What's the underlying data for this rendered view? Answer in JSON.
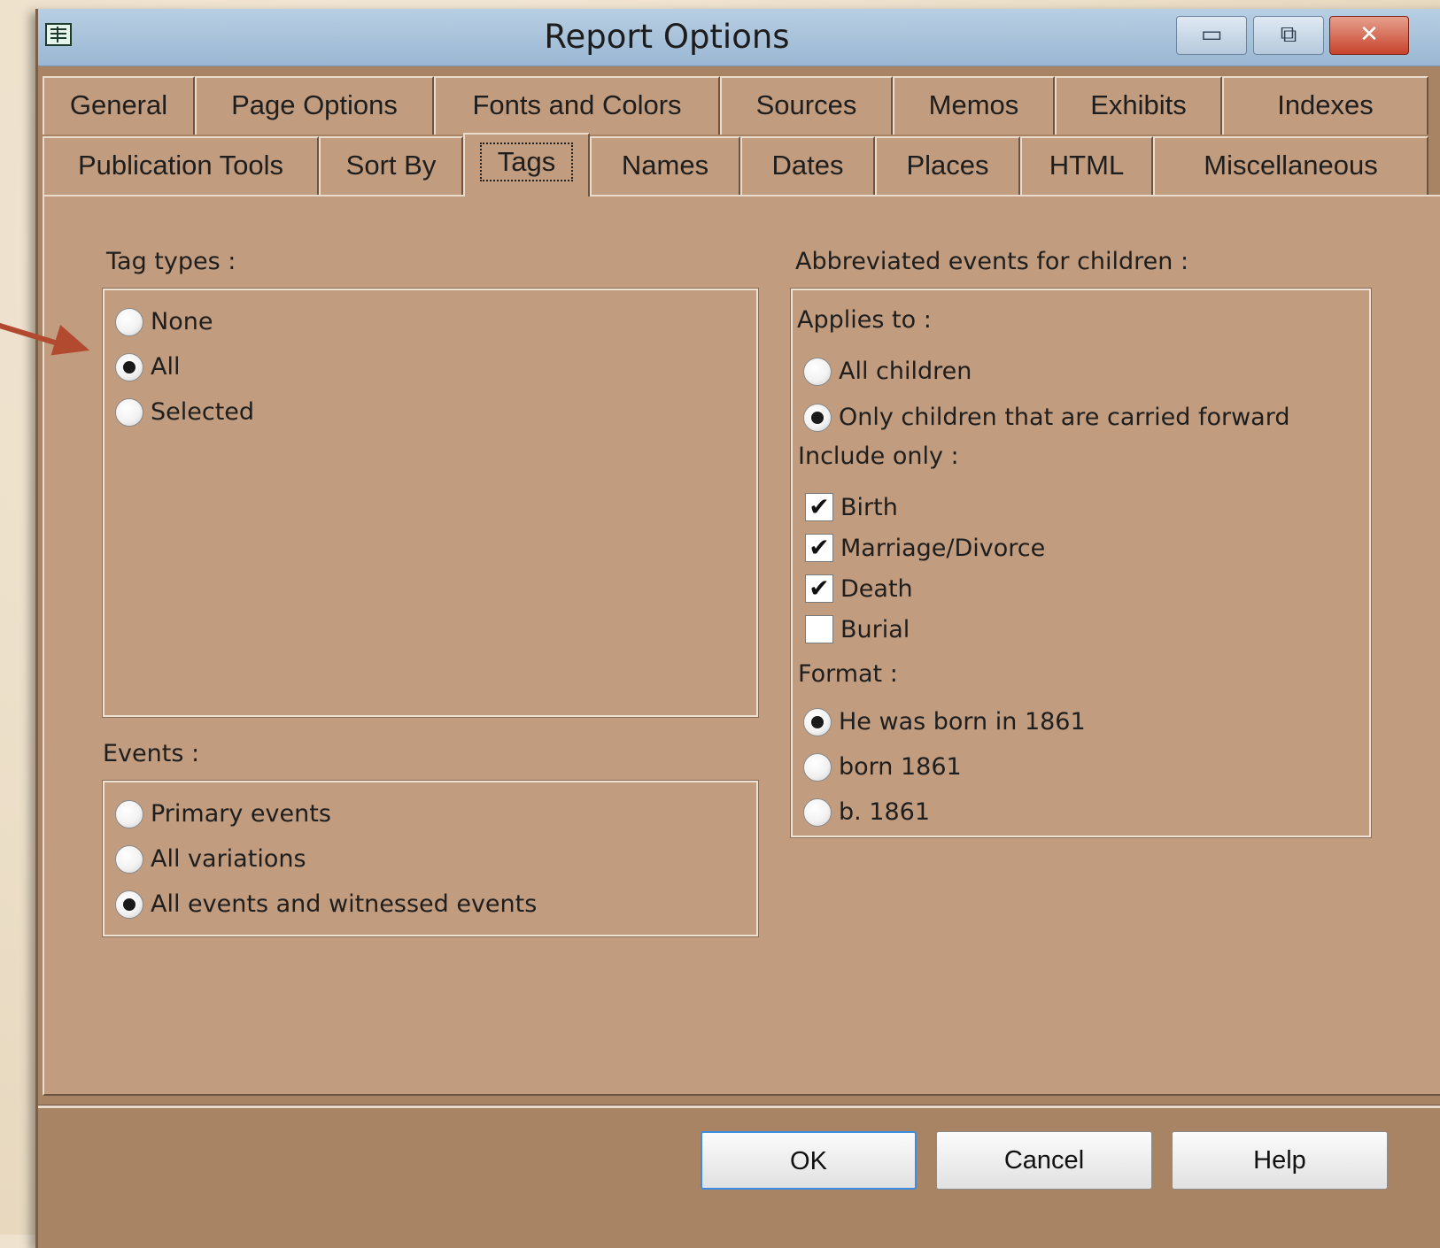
{
  "window": {
    "title": "Report Options",
    "controls": {
      "minimize": "▭",
      "maximize": "⧉",
      "close": "✕"
    }
  },
  "tabs": {
    "row1": [
      "General",
      "Page Options",
      "Fonts and Colors",
      "Sources",
      "Memos",
      "Exhibits",
      "Indexes"
    ],
    "row2": [
      "Publication Tools",
      "Sort By",
      "Tags",
      "Names",
      "Dates",
      "Places",
      "HTML",
      "Miscellaneous"
    ],
    "active": "Tags"
  },
  "tag_types": {
    "label": "Tag types :",
    "options": [
      "None",
      "All",
      "Selected"
    ],
    "selected": "All"
  },
  "events": {
    "label": "Events :",
    "options": [
      "Primary events",
      "All variations",
      "All events and witnessed events"
    ],
    "selected": "All events and witnessed events"
  },
  "abbrev": {
    "label": "Abbreviated events for children :",
    "applies_label": "Applies to :",
    "applies_options": [
      "All children",
      "Only children that are carried forward"
    ],
    "applies_selected": "Only children that are carried forward",
    "include_label": "Include only :",
    "include": [
      {
        "label": "Birth",
        "checked": true
      },
      {
        "label": "Marriage/Divorce",
        "checked": true
      },
      {
        "label": "Death",
        "checked": true
      },
      {
        "label": "Burial",
        "checked": false
      }
    ],
    "format_label": "Format :",
    "format_options": [
      "He was born in 1861",
      "born 1861",
      "b. 1861"
    ],
    "format_selected": "He was born in 1861"
  },
  "buttons": {
    "ok": "OK",
    "cancel": "Cancel",
    "help": "Help"
  },
  "colors": {
    "dialog": "#c19c7f",
    "annotation_arrow": "#b24a30"
  }
}
